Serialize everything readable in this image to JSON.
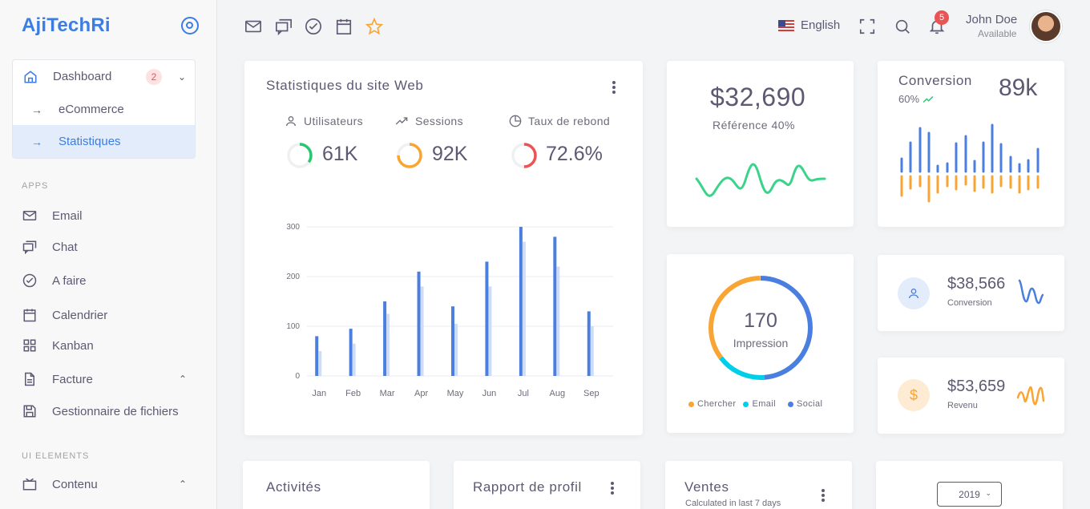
{
  "brand": {
    "part1": "Aji",
    "part2": "TechRi"
  },
  "sidebar": {
    "dashboard": {
      "label": "Dashboard",
      "badge": "2"
    },
    "sub_items": [
      "eCommerce",
      "Statistiques"
    ],
    "apps_title": "APPS",
    "apps": [
      "Email",
      "Chat",
      "A faire",
      "Calendrier",
      "Kanban",
      "Facture",
      "Gestionnaire de fichiers"
    ],
    "ui_title": "UI ELEMENTS",
    "ui": [
      "Contenu"
    ]
  },
  "topbar": {
    "language": "English",
    "notification_count": "5",
    "user_name": "John Doe",
    "user_status": "Available"
  },
  "stats_card": {
    "title": "Statistiques du site Web",
    "kpis": [
      {
        "label": "Utilisateurs",
        "value": "61K",
        "color": "#28c76f",
        "fraction": 0.35
      },
      {
        "label": "Sessions",
        "value": "92K",
        "color": "#f8a534",
        "fraction": 0.75
      },
      {
        "label": "Taux de rebond",
        "value": "72.6%",
        "color": "#ea5455",
        "fraction": 0.5
      }
    ]
  },
  "chart_data": {
    "type": "bar",
    "categories": [
      "Jan",
      "Feb",
      "Mar",
      "Apr",
      "May",
      "Jun",
      "Jul",
      "Aug",
      "Sep"
    ],
    "series": [
      {
        "values": [
          80,
          95,
          150,
          210,
          140,
          230,
          300,
          280,
          130
        ],
        "color": "#4a7fe0"
      },
      {
        "values": [
          50,
          65,
          125,
          180,
          105,
          180,
          270,
          220,
          100
        ],
        "color": "#cfdcf8"
      }
    ],
    "yticks": [
      0,
      100,
      200,
      300
    ],
    "ylim": [
      0,
      300
    ],
    "grid": true
  },
  "revenue_card": {
    "value": "$32,690",
    "label": "Référence 40%",
    "line_color": "#39d48a"
  },
  "conversion_card": {
    "title": "Conversion",
    "percent": "60%",
    "value": "89k"
  },
  "impression_card": {
    "value": "170",
    "label": "Impression",
    "legend": [
      {
        "name": "Chercher",
        "color": "#f8a534"
      },
      {
        "name": "Email",
        "color": "#00cfe8"
      },
      {
        "name": "Social",
        "color": "#4a7fe0"
      }
    ]
  },
  "mini_cards": [
    {
      "value": "$38,566",
      "label": "Conversion",
      "color": "#4a7fe0"
    },
    {
      "value": "$53,659",
      "label": "Revenu",
      "color": "#f8a534"
    }
  ],
  "bottom_cards": {
    "activities": "Activités",
    "profile": "Rapport de profil",
    "sales": "Ventes",
    "sales_sub": "Calculated in last 7 days",
    "year": "2019"
  }
}
